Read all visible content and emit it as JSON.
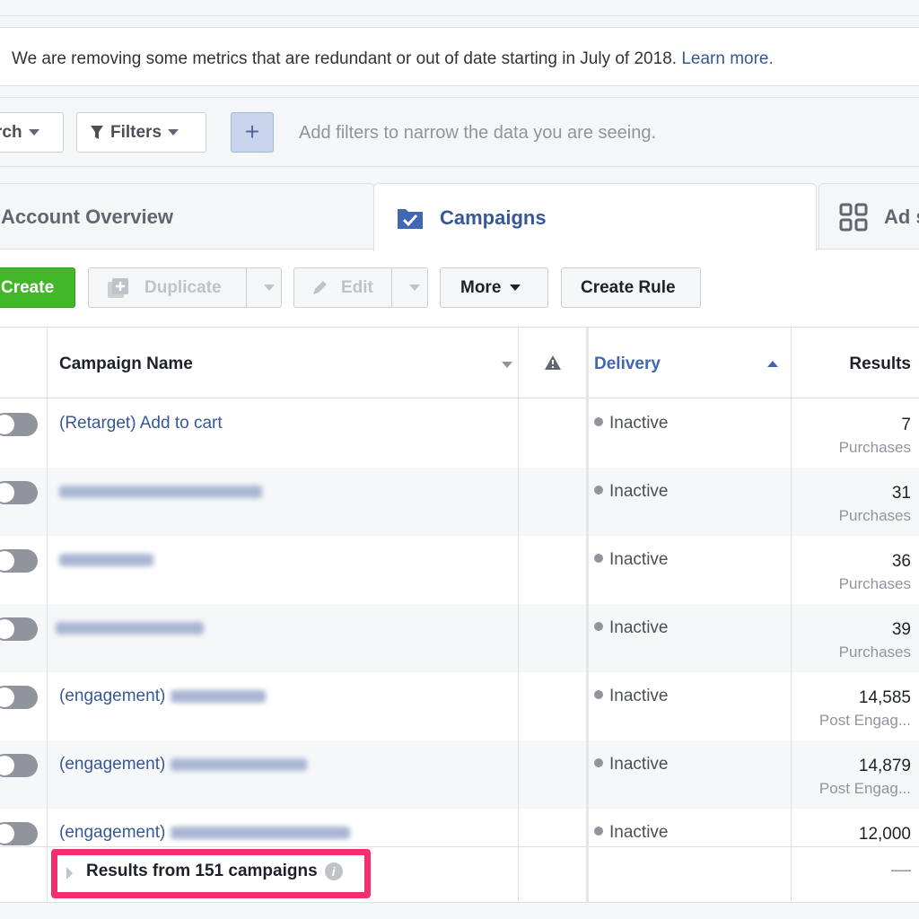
{
  "notice": {
    "text": "We are removing some metrics that are redundant or out of date starting in July of 2018.",
    "link": "Learn more."
  },
  "filterbar": {
    "search_label": "rch",
    "filters_label": "Filters",
    "add_label": "+",
    "hint": "Add filters to narrow the data you are seeing."
  },
  "tabs": [
    {
      "label": "Account Overview"
    },
    {
      "label": "Campaigns",
      "active": true
    },
    {
      "label": "Ad s"
    }
  ],
  "toolbar": {
    "create": "Create",
    "duplicate": "Duplicate",
    "edit": "Edit",
    "more": "More",
    "create_rule": "Create Rule"
  },
  "colors": {
    "create_green": "#42b72a",
    "link_blue": "#365899",
    "highlight_pink": "#f2306d"
  },
  "table": {
    "columns": {
      "name": "Campaign Name",
      "delivery": "Delivery",
      "results": "Results"
    },
    "sort": "delivery-ascending",
    "rows": [
      {
        "name": "(Retarget) Add to cart",
        "delivery": "Inactive",
        "result": "7",
        "result_type": "Purchases"
      },
      {
        "name": "",
        "delivery": "Inactive",
        "result": "31",
        "result_type": "Purchases"
      },
      {
        "name": "",
        "delivery": "Inactive",
        "result": "36",
        "result_type": "Purchases"
      },
      {
        "name": "",
        "delivery": "Inactive",
        "result": "39",
        "result_type": "Purchases"
      },
      {
        "name": "(engagement)",
        "delivery": "Inactive",
        "result": "14,585",
        "result_type": "Post Engag..."
      },
      {
        "name": "(engagement)",
        "delivery": "Inactive",
        "result": "14,879",
        "result_type": "Post Engag..."
      },
      {
        "name": "(engagement)",
        "delivery": "Inactive",
        "result": "12,000",
        "result_type": ""
      }
    ],
    "footer": {
      "summary": "Results from 151 campaigns",
      "results_total": "—"
    }
  }
}
